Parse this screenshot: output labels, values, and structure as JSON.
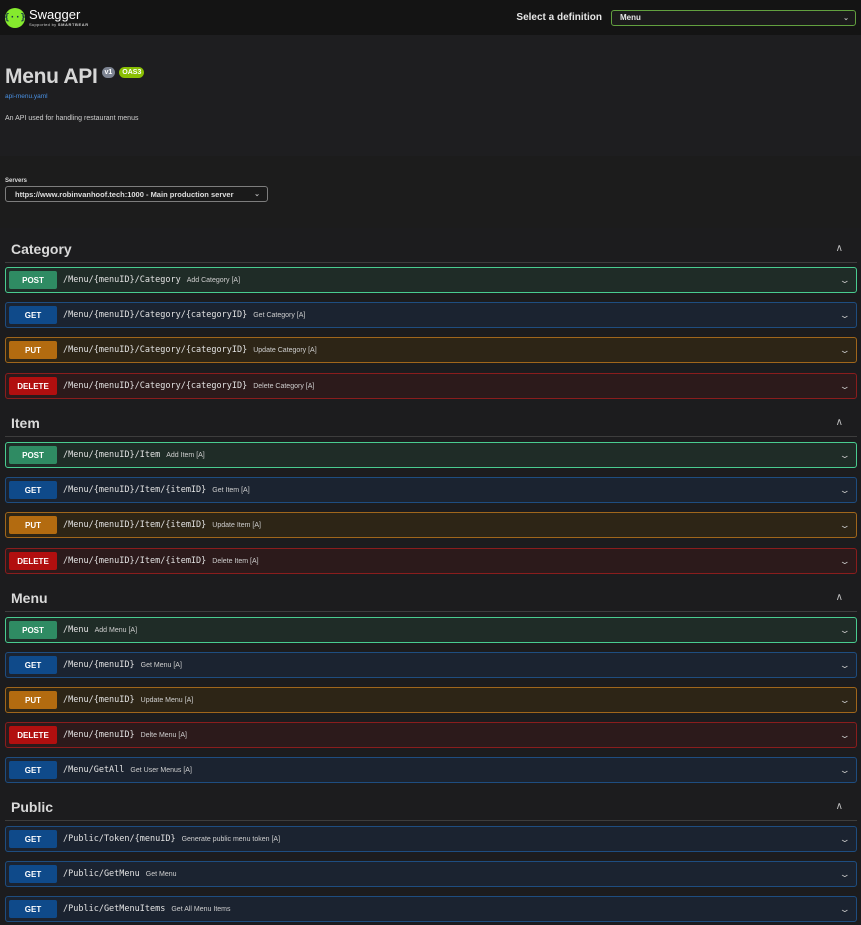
{
  "topbar": {
    "brand_name": "Swagger",
    "brand_sub_prefix": "Supported by",
    "brand_sub_company": "SMARTBEAR",
    "definition_label": "Select a definition",
    "definition_value": "Menu"
  },
  "info": {
    "title": "Menu API",
    "version_badge": "v1",
    "oas_badge": "OAS3",
    "spec_link": "api-menu.yaml",
    "description": "An API used for handling restaurant menus"
  },
  "servers": {
    "label": "Servers",
    "selected": "https://www.robinvanhoof.tech:1000 - Main production server"
  },
  "tags": [
    {
      "name": "Category",
      "operations": [
        {
          "method": "POST",
          "path": "/Menu/{menuID}/Category",
          "summary": "Add Category [A]"
        },
        {
          "method": "GET",
          "path": "/Menu/{menuID}/Category/{categoryID}",
          "summary": "Get Category [A]"
        },
        {
          "method": "PUT",
          "path": "/Menu/{menuID}/Category/{categoryID}",
          "summary": "Update Category [A]"
        },
        {
          "method": "DELETE",
          "path": "/Menu/{menuID}/Category/{categoryID}",
          "summary": "Delete Category [A]"
        }
      ]
    },
    {
      "name": "Item",
      "operations": [
        {
          "method": "POST",
          "path": "/Menu/{menuID}/Item",
          "summary": "Add Item [A]"
        },
        {
          "method": "GET",
          "path": "/Menu/{menuID}/Item/{itemID}",
          "summary": "Get Item [A]"
        },
        {
          "method": "PUT",
          "path": "/Menu/{menuID}/Item/{itemID}",
          "summary": "Update Item [A]"
        },
        {
          "method": "DELETE",
          "path": "/Menu/{menuID}/Item/{itemID}",
          "summary": "Delete Item [A]"
        }
      ]
    },
    {
      "name": "Menu",
      "operations": [
        {
          "method": "POST",
          "path": "/Menu",
          "summary": "Add Menu [A]"
        },
        {
          "method": "GET",
          "path": "/Menu/{menuID}",
          "summary": "Get Menu [A]"
        },
        {
          "method": "PUT",
          "path": "/Menu/{menuID}",
          "summary": "Update Menu [A]"
        },
        {
          "method": "DELETE",
          "path": "/Menu/{menuID}",
          "summary": "Delte Menu [A]"
        },
        {
          "method": "GET",
          "path": "/Menu/GetAll",
          "summary": "Get User Menus [A]"
        }
      ]
    },
    {
      "name": "Public",
      "operations": [
        {
          "method": "GET",
          "path": "/Public/Token/{menuID}",
          "summary": "Generate public menu token [A]"
        },
        {
          "method": "GET",
          "path": "/Public/GetMenu",
          "summary": "Get Menu"
        },
        {
          "method": "GET",
          "path": "/Public/GetMenuItems",
          "summary": "Get All Menu Items"
        }
      ]
    }
  ],
  "colors": {
    "post": "#49cc90",
    "get": "#0f4a8a",
    "put": "#b36b10",
    "delete": "#b10f0f",
    "brand": "#85ea2d"
  }
}
